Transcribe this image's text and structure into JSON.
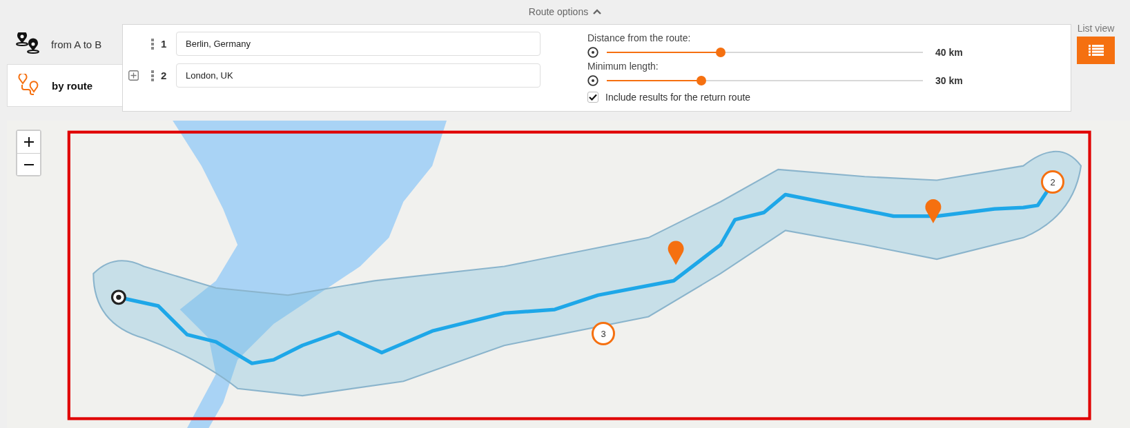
{
  "route_options": {
    "label": "Route options",
    "expanded": true
  },
  "tabs": [
    {
      "kind": "points",
      "label": "from A to B",
      "selected": false
    },
    {
      "kind": "route",
      "label": "by route",
      "selected": true
    }
  ],
  "waypoints": [
    {
      "number": "1",
      "value": "Berlin, Germany"
    },
    {
      "number": "2",
      "value": "London, UK"
    }
  ],
  "sliders": [
    {
      "label": "Distance from the route:",
      "level": 0.36,
      "reading": "40 km"
    },
    {
      "label": "Minimum length:",
      "level": 0.3,
      "reading": "30 km"
    }
  ],
  "return_route": {
    "label": "Include results for the return route",
    "checked": true
  },
  "list_view": {
    "label": "List view"
  },
  "map": {
    "clusters": [
      "2",
      "3"
    ]
  }
}
